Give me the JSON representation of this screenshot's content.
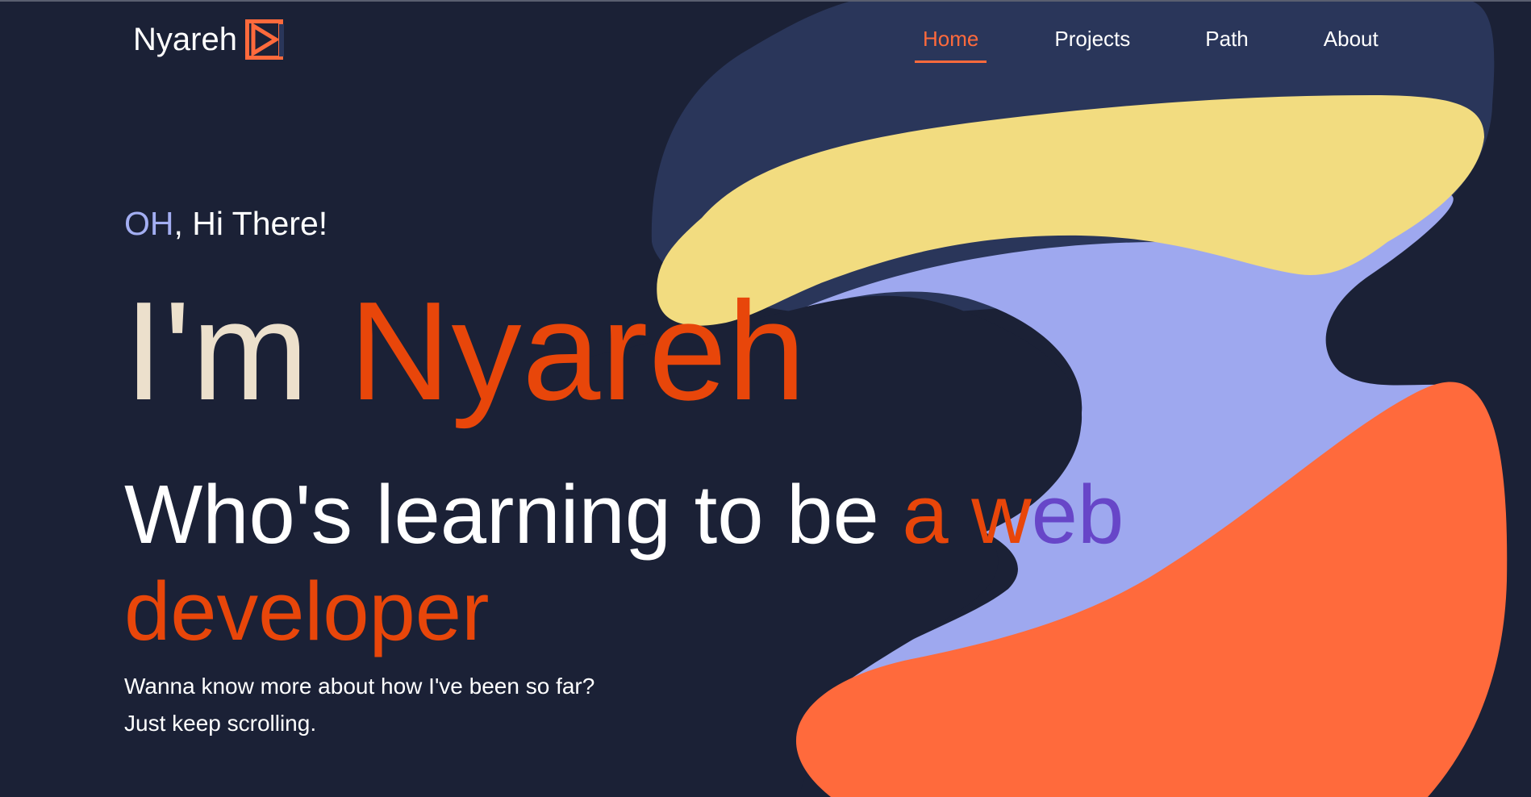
{
  "navbar": {
    "brand": "Nyareh",
    "links": [
      {
        "label": "Home",
        "active": true
      },
      {
        "label": "Projects",
        "active": false
      },
      {
        "label": "Path",
        "active": false
      },
      {
        "label": "About",
        "active": false
      }
    ]
  },
  "hero": {
    "greeting_accent": "OH",
    "greeting_rest": ", Hi There!",
    "title_prefix": "I'm ",
    "title_name": "Nyareh",
    "subtitle_plain": "Who's learning to be ",
    "subtitle_accent_1": "a w",
    "subtitle_accent_2": "eb",
    "subtitle_accent_3": "developer",
    "blurb_line_1": "Wanna know more about how I've been so far?",
    "blurb_line_2": "Just keep scrolling."
  },
  "colors": {
    "background": "#1b2136",
    "accent_orange": "#e8460a",
    "nav_active": "#ff6a3c",
    "periwinkle": "#9ea8ef",
    "yellow": "#f2dc80",
    "navy_blob": "#2a365a",
    "cream": "#ece0cc",
    "purple": "#6746c8"
  },
  "icons": {
    "brand_logo": "play-skip-logo-icon"
  }
}
